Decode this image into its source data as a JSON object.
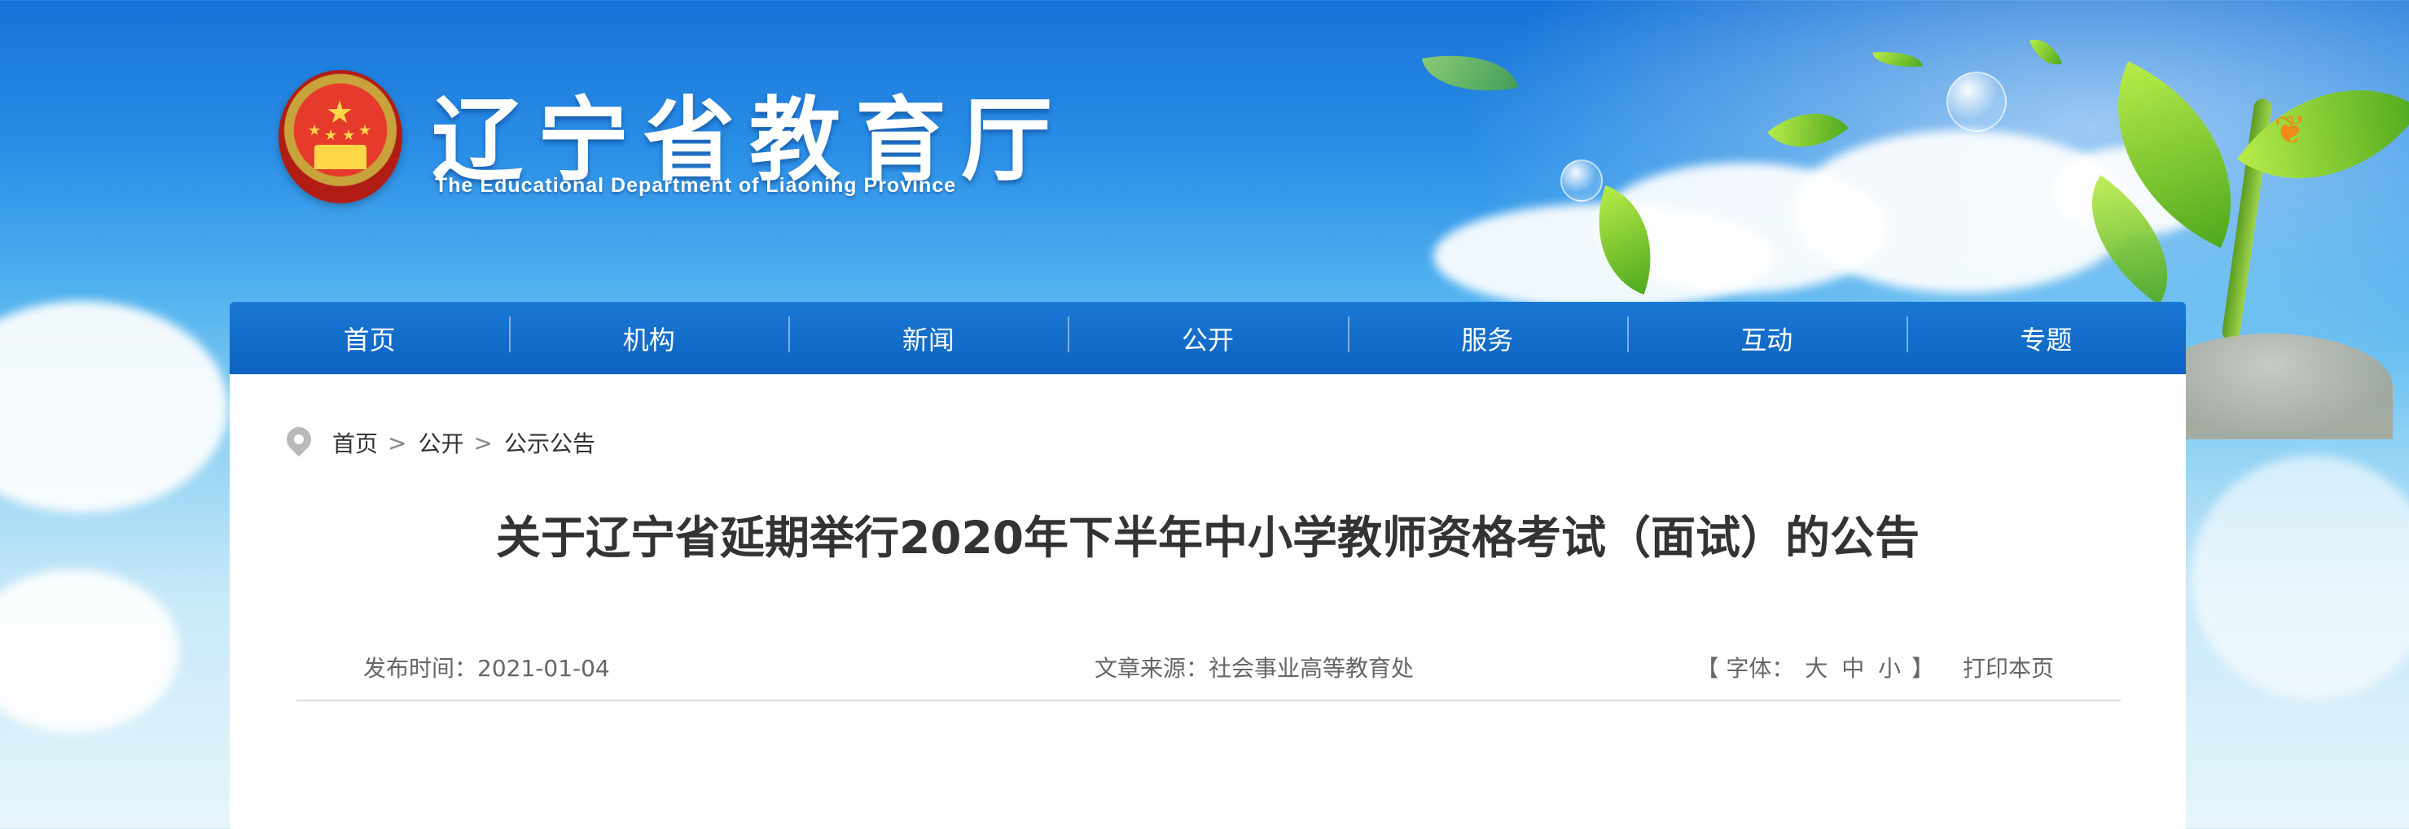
{
  "header": {
    "title": "辽宁省教育厅",
    "subtitle": "The Educational Department of Liaoning Province"
  },
  "nav": {
    "items": [
      "首页",
      "机构",
      "新闻",
      "公开",
      "服务",
      "互动",
      "专题"
    ]
  },
  "breadcrumb": {
    "items": [
      "首页",
      "公开",
      "公示公告"
    ],
    "separator": ">"
  },
  "article": {
    "title": "关于辽宁省延期举行2020年下半年中小学教师资格考试（面试）的公告",
    "publish_label": "发布时间：",
    "publish_date": "2021-01-04",
    "source_label": "文章来源：",
    "source": "社会事业高等教育处",
    "font_bracket_open": "【",
    "font_label": "字体：",
    "font_large": "大",
    "font_medium": "中",
    "font_small": "小",
    "font_bracket_close": "】",
    "print_label": "打印本页"
  },
  "colors": {
    "nav_bg": "#0d63c0",
    "title_text": "#333333",
    "meta_text": "#666666"
  },
  "icons": [
    "national-emblem",
    "location-pin-icon"
  ]
}
